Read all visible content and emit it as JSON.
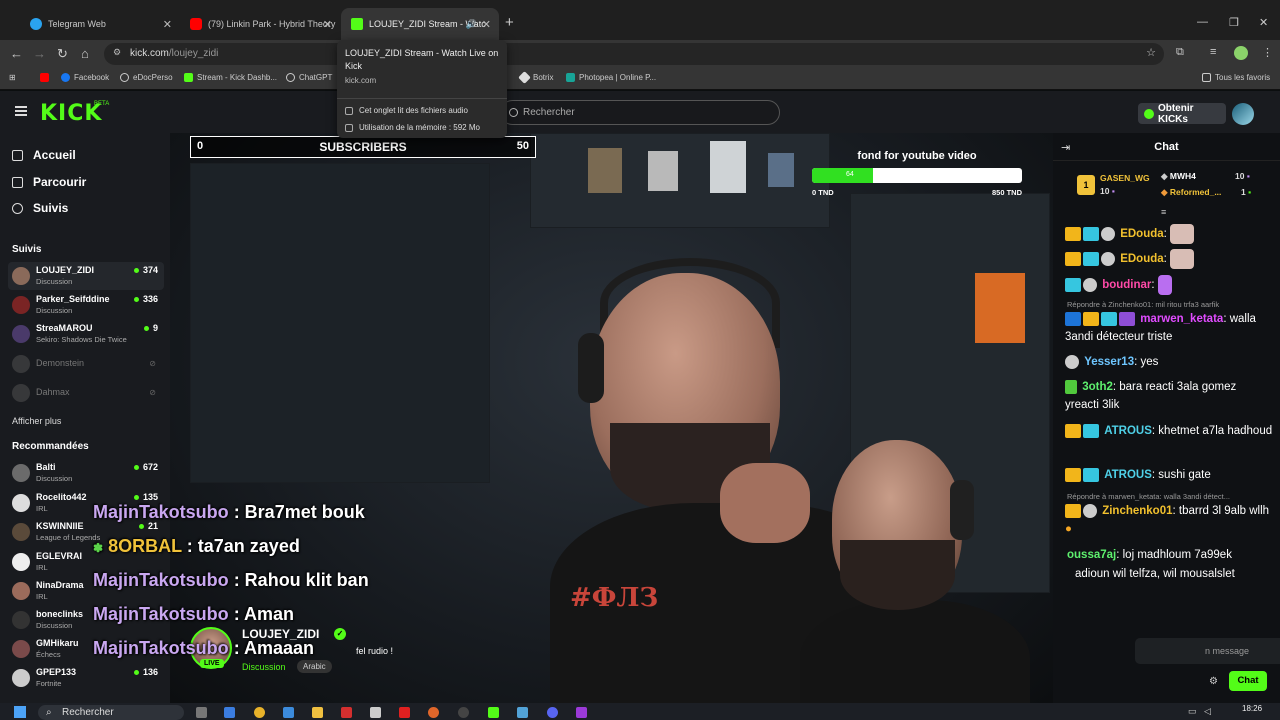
{
  "browser": {
    "tabs": [
      {
        "label": "Telegram Web",
        "color": "#2aa3ef"
      },
      {
        "label": "(79) Linkin Park - Hybrid Theory",
        "color": "#ff0000"
      },
      {
        "label": "LOUJEY_ZIDI Stream - Watc",
        "color": "#53fc18"
      }
    ],
    "url_host": "kick.com",
    "url_path": "/loujey_zidi",
    "bookmarks": [
      "Facebook",
      "eDocPerso",
      "Stream - Kick Dashb...",
      "ChatGPT",
      "Botrix",
      "Photopea | Online P..."
    ],
    "all_bookmarks": "Tous les favoris",
    "tab_popup": {
      "title": "LOUJEY_ZIDI Stream - Watch Live on Kick",
      "domain": "kick.com",
      "audio": "Cet onglet lit des fichiers audio",
      "memory": "Utilisation de la mémoire : 592 Mo"
    }
  },
  "kick": {
    "logo": "KICK",
    "beta": "BETA",
    "search_placeholder": "Rechercher",
    "kicks_button": "Obtenir KICKs"
  },
  "sidebar": {
    "nav": [
      "Accueil",
      "Parcourir",
      "Suivis"
    ],
    "following_title": "Suivis",
    "following": [
      {
        "name": "LOUJEY_ZIDI",
        "category": "Discussion",
        "viewers": "374"
      },
      {
        "name": "Parker_Seifddine",
        "category": "Discussion",
        "viewers": "336"
      },
      {
        "name": "StreaMAROU",
        "category": "Sekiro: Shadows Die Twice",
        "viewers": "9"
      },
      {
        "name": "Demonstein"
      },
      {
        "name": "Dahmax"
      }
    ],
    "show_more": "Afficher plus",
    "recommended_title": "Recommandées",
    "recommended": [
      {
        "name": "Balti",
        "category": "Discussion",
        "viewers": "672"
      },
      {
        "name": "Rocelito442",
        "category": "IRL",
        "viewers": "135"
      },
      {
        "name": "KSWINNIIE",
        "category": "League of Legends",
        "viewers": "21"
      },
      {
        "name": "EGLEVRAI",
        "category": "IRL",
        "viewers": ""
      },
      {
        "name": "NinaDrama",
        "category": "IRL",
        "viewers": ""
      },
      {
        "name": "boneclinks",
        "category": "Discussion",
        "viewers": ""
      },
      {
        "name": "GMHikaru",
        "category": "Échecs",
        "viewers": ""
      },
      {
        "name": "GPEP133",
        "category": "Fortnite",
        "viewers": "136"
      }
    ]
  },
  "overlay": {
    "sub_start": "0",
    "sub_label": "SUBSCRIBERS",
    "sub_end": "50",
    "goal_title": "fond for youtube video",
    "goal_current": "64",
    "goal_fraction": 0.29,
    "goal_min": "0 TND",
    "goal_max": "850 TND",
    "chat_lines": [
      {
        "user": "MajinTakotsubo",
        "msg": ": Bra7met bouk",
        "gold": false
      },
      {
        "user": "8ORBAL",
        "msg": ": ta7an zayed",
        "gold": true
      },
      {
        "user": "MajinTakotsubo",
        "msg": ": Rahou klit ban",
        "gold": false
      },
      {
        "user": "MajinTakotsubo",
        "msg": ": Aman",
        "gold": false
      },
      {
        "user": "MajinTakotsubo",
        "msg": ": Amaaan",
        "gold": false
      }
    ],
    "shirt_print": "#ФЛЗ"
  },
  "streamer": {
    "name": "LOUJEY_ZIDI",
    "live": "LIVE",
    "title": "fel rudio !",
    "category": "Discussion",
    "tag": "Arabic"
  },
  "chat": {
    "title": "Chat",
    "top_gifters": [
      {
        "name": "GASEN_WG",
        "count": "10"
      },
      {
        "name": "MWH4",
        "count": "10"
      },
      {
        "name": "Reformed_...",
        "count": "1"
      }
    ],
    "rank": "1",
    "messages": [
      {
        "user": "EDouda",
        "text": "",
        "color": "#f2c12e"
      },
      {
        "user": "EDouda",
        "text": "",
        "color": "#f2c12e"
      },
      {
        "user": "boudinar",
        "text": "",
        "color": "#ff4aa8"
      },
      {
        "reply": "Répondre à Zinchenko01: mil ritou trfa3 aarfik"
      },
      {
        "user": "marwen_ketata",
        "text": "walla 3andi détecteur triste",
        "color": "#e04cff"
      },
      {
        "user": "Yesser13",
        "text": "yes",
        "color": "#6ec6ff"
      },
      {
        "user": "3oth2",
        "text": "bara reacti 3ala gomez yreacti 3lik",
        "color": "#5ef06e"
      },
      {
        "user": "ATROUS",
        "text": "khetmet a7la hadhoud",
        "color": "#4fd1e8"
      },
      {
        "user": "ATROUS",
        "text": "sushi gate",
        "color": "#4fd1e8"
      },
      {
        "reply": "Répondre à marwen_ketata: walla 3andi détect..."
      },
      {
        "user": "Zinchenko01",
        "text": "tbarrd 3l 9alb wllh",
        "color": "#f2c12e"
      },
      {
        "user": "oussa7aj",
        "text": "loj madhloum 7a99ek",
        "color": "#5ef06e"
      },
      {
        "user": "",
        "text": "adioun wil telfza, wil mousalslet",
        "color": "#ffffff"
      }
    ],
    "input_placeholder": "n message",
    "send_label": "Chat"
  },
  "taskbar": {
    "search_placeholder": "Rechercher",
    "time": "18:26"
  }
}
